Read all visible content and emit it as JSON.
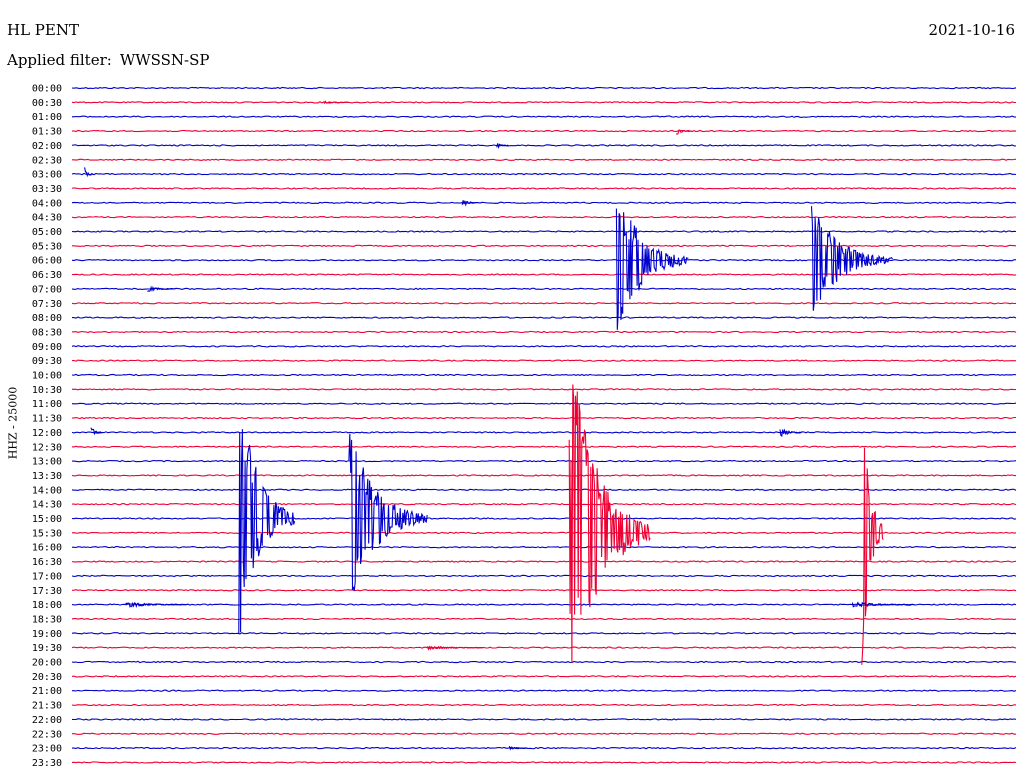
{
  "header": {
    "station": "HL PENT",
    "date": "2021-10-16",
    "filter_label": "Applied filter:",
    "filter_value": "WWSSN-SP"
  },
  "colors": {
    "blue": "#0000cc",
    "red": "#ee0033",
    "text": "#000000"
  },
  "chart_data": {
    "type": "helicorder",
    "title": "",
    "ylabel": "HHZ - 25000",
    "xlabel": "",
    "row_minutes": 30,
    "row_labels": [
      "00:00",
      "00:30",
      "01:00",
      "01:30",
      "02:00",
      "02:30",
      "03:00",
      "03:30",
      "04:00",
      "04:30",
      "05:00",
      "05:30",
      "06:00",
      "06:30",
      "07:00",
      "07:30",
      "08:00",
      "08:30",
      "09:00",
      "09:30",
      "10:00",
      "10:30",
      "11:00",
      "11:30",
      "12:00",
      "12:30",
      "13:00",
      "13:30",
      "14:00",
      "14:30",
      "15:00",
      "15:30",
      "16:00",
      "16:30",
      "17:00",
      "17:30",
      "18:00",
      "18:30",
      "19:00",
      "19:30",
      "20:00",
      "20:30",
      "21:00",
      "21:30",
      "22:00",
      "22:30",
      "23:00",
      "23:30"
    ],
    "row_colors": [
      "blue",
      "red"
    ],
    "events": [
      {
        "row": 1,
        "minute": 8,
        "duration": 0.8,
        "amplitude": 2,
        "color": "red"
      },
      {
        "row": 3,
        "minute": 19.2,
        "duration": 0.5,
        "amplitude": 4,
        "color": "red"
      },
      {
        "row": 4,
        "minute": 13.5,
        "duration": 0.4,
        "amplitude": 3,
        "color": "blue"
      },
      {
        "row": 6,
        "minute": 0.4,
        "duration": 0.3,
        "amplitude": 7,
        "color": "blue"
      },
      {
        "row": 8,
        "minute": 12.4,
        "duration": 0.5,
        "amplitude": 4,
        "color": "blue"
      },
      {
        "row": 12,
        "minute": 17.3,
        "duration": 2.3,
        "amplitude": 82,
        "color": "blue"
      },
      {
        "row": 12,
        "minute": 23.5,
        "duration": 2.6,
        "amplitude": 58,
        "color": "blue"
      },
      {
        "row": 14,
        "minute": 2.4,
        "duration": 0.9,
        "amplitude": 3,
        "color": "blue"
      },
      {
        "row": 24,
        "minute": 0.6,
        "duration": 0.4,
        "amplitude": 6,
        "color": "blue"
      },
      {
        "row": 24,
        "minute": 22.5,
        "duration": 0.7,
        "amplitude": 5,
        "color": "blue"
      },
      {
        "row": 30,
        "minute": 5.3,
        "duration": 1.8,
        "amplitude": 136,
        "color": "blue"
      },
      {
        "row": 30,
        "minute": 8.8,
        "duration": 2.5,
        "amplitude": 92,
        "color": "blue"
      },
      {
        "row": 31,
        "minute": 15.8,
        "duration": 2.6,
        "amplitude": 195,
        "color": "red"
      },
      {
        "row": 31,
        "minute": 25.1,
        "duration": 0.7,
        "amplitude": 155,
        "color": "red"
      },
      {
        "row": 36,
        "minute": 1.7,
        "duration": 2.0,
        "amplitude": 3,
        "color": "blue"
      },
      {
        "row": 36,
        "minute": 24.8,
        "duration": 2.0,
        "amplitude": 3,
        "color": "blue"
      },
      {
        "row": 39,
        "minute": 11.3,
        "duration": 1.8,
        "amplitude": 2,
        "color": "red"
      },
      {
        "row": 46,
        "minute": 13.9,
        "duration": 0.6,
        "amplitude": 2,
        "color": "blue"
      }
    ]
  }
}
